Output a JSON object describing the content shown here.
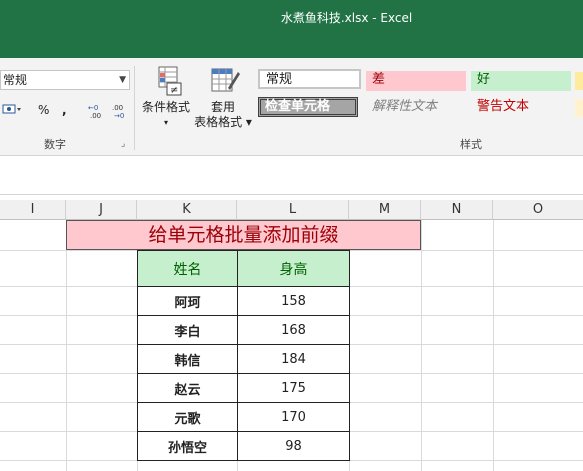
{
  "window": {
    "title": "水煮鱼科技.xlsx - Excel"
  },
  "ribbon": {
    "number": {
      "format_value": "常规",
      "percent": "%",
      "comma": ",",
      "group_label": "数字"
    },
    "conditional_format": {
      "line1": "条件格式",
      "line2": "▾"
    },
    "format_as_table": {
      "line1": "套用",
      "line2": "表格格式 ▾"
    },
    "styles": {
      "normal": "常规",
      "bad": "差",
      "good": "好",
      "check_cell": "检查单元格",
      "explanatory": "解释性文本",
      "warning": "警告文本",
      "group_label": "样式"
    }
  },
  "columns": [
    "I",
    "J",
    "K",
    "L",
    "M",
    "N",
    "O"
  ],
  "sheet": {
    "banner": "给单元格批量添加前缀",
    "table": {
      "headers": [
        "姓名",
        "身高"
      ],
      "rows": [
        [
          "阿珂",
          "158"
        ],
        [
          "李白",
          "168"
        ],
        [
          "韩信",
          "184"
        ],
        [
          "赵云",
          "175"
        ],
        [
          "元歌",
          "170"
        ],
        [
          "孙悟空",
          "98"
        ]
      ]
    }
  },
  "colors": {
    "excel_green": "#217346",
    "bad_fill": "#ffc7ce",
    "good_fill": "#c6efce",
    "bad_text": "#9c0006",
    "good_text": "#006100"
  }
}
